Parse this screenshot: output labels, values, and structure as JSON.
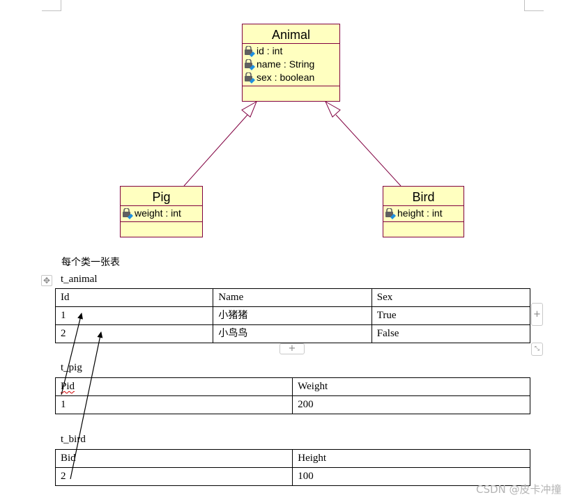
{
  "uml": {
    "classes": [
      {
        "name": "Animal",
        "attributes": [
          "id : int",
          "name : String",
          "sex : boolean"
        ]
      },
      {
        "name": "Pig",
        "attributes": [
          "weight : int"
        ]
      },
      {
        "name": "Bird",
        "attributes": [
          "height : int"
        ]
      }
    ],
    "relations": [
      {
        "type": "generalization",
        "from": "Pig",
        "to": "Animal"
      },
      {
        "type": "generalization",
        "from": "Bird",
        "to": "Animal"
      }
    ],
    "colors": {
      "class_fill": "#ffffc0",
      "class_border": "#800040",
      "line": "#800040"
    },
    "attribute_icon": "private-field-icon"
  },
  "document": {
    "heading": "每个类一张表",
    "tables": [
      {
        "caption": "t_animal",
        "headers": [
          "Id",
          "Name",
          "Sex"
        ],
        "rows": [
          [
            "1",
            "小猪猪",
            "True"
          ],
          [
            "2",
            "小鸟鸟",
            "False"
          ]
        ]
      },
      {
        "caption": "t_pig",
        "headers": [
          "Pid",
          "Weight"
        ],
        "rows": [
          [
            "1",
            "200"
          ]
        ]
      },
      {
        "caption": "t_bird",
        "headers": [
          "Bid",
          "Height"
        ],
        "rows": [
          [
            "2",
            "100"
          ]
        ]
      }
    ],
    "table_controls": {
      "move_icon": "move-icon",
      "add_column_label": "+",
      "add_row_label": "+",
      "resize_icon": "resize-icon"
    },
    "annotations": [
      {
        "type": "arrow",
        "from": "t_pig.Pid",
        "to": "t_animal.row1.Id"
      },
      {
        "type": "arrow",
        "from": "t_bird.row1.Bid",
        "to": "t_animal.row2.Id"
      }
    ]
  },
  "watermark": "CSDN @皮卡冲撞"
}
